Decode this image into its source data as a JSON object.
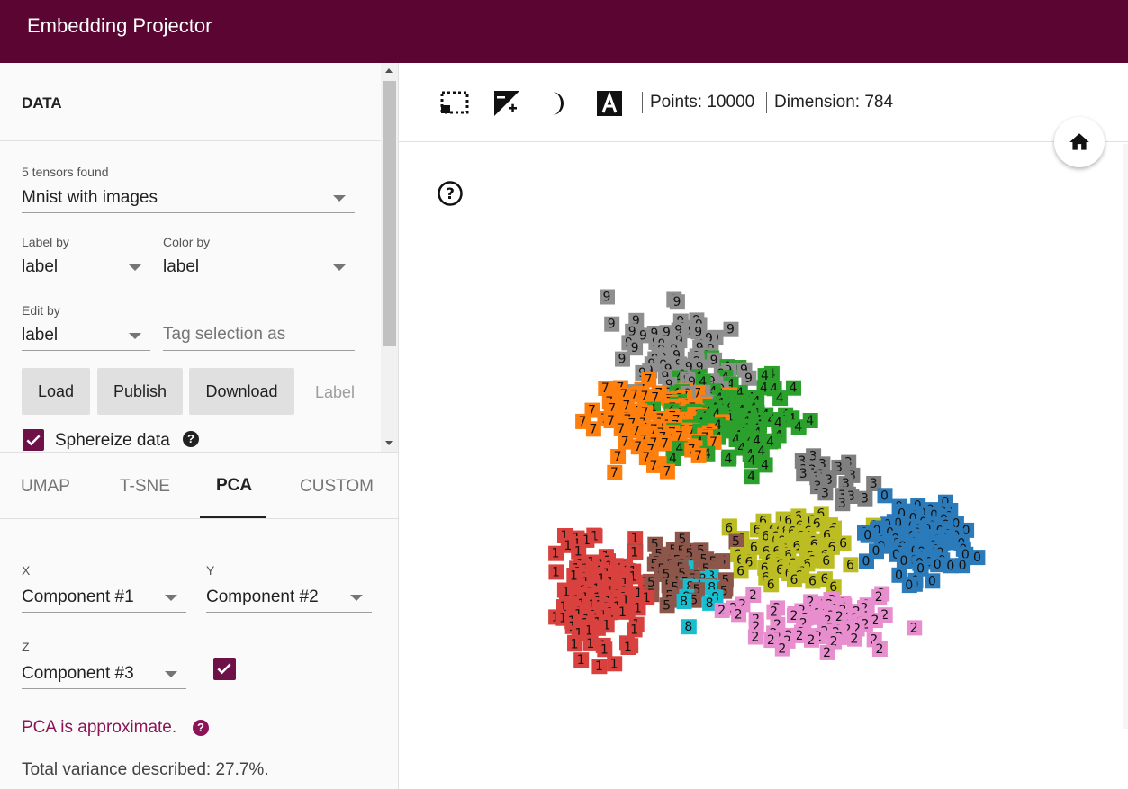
{
  "header": {
    "title": "Embedding Projector"
  },
  "data_panel": {
    "title": "DATA",
    "tensors_found": "5 tensors found",
    "tensor_select": "Mnist with images",
    "label_by": {
      "label": "Label by",
      "value": "label"
    },
    "color_by": {
      "label": "Color by",
      "value": "label"
    },
    "edit_by": {
      "label": "Edit by",
      "value": "label"
    },
    "tag_placeholder": "Tag selection as",
    "buttons": {
      "load": "Load",
      "publish": "Publish",
      "download": "Download",
      "label": "Label"
    },
    "sphereize": {
      "label": "Sphereize data",
      "checked": true
    }
  },
  "tabs": [
    {
      "label": "UMAP",
      "active": false
    },
    {
      "label": "T-SNE",
      "active": false
    },
    {
      "label": "PCA",
      "active": true
    },
    {
      "label": "CUSTOM",
      "active": false
    }
  ],
  "pca": {
    "x": {
      "label": "X",
      "value": "Component #1"
    },
    "y": {
      "label": "Y",
      "value": "Component #2"
    },
    "z": {
      "label": "Z",
      "value": "Component #3",
      "enabled": true
    },
    "approx_note": "PCA is approximate.",
    "variance": "Total variance described: 27.7%."
  },
  "toolbar": {
    "icons": [
      "selection-rect-icon",
      "night-mode-contrast-icon",
      "moon-icon",
      "labels-icon"
    ],
    "points": "Points: 10000",
    "dimension": "Dimension: 784"
  },
  "colors": {
    "header_bg": "#5a0532",
    "accent": "#6d1146",
    "digit_colors": {
      "0": "#2b7bba",
      "1": "#d9413e",
      "2": "#e88ecf",
      "3": "#7f7f7f",
      "4": "#2ca02c",
      "5": "#8c564b",
      "6": "#bcbd22",
      "7": "#ff7f0e",
      "8": "#17becf",
      "9": "#8f8f8f"
    }
  }
}
